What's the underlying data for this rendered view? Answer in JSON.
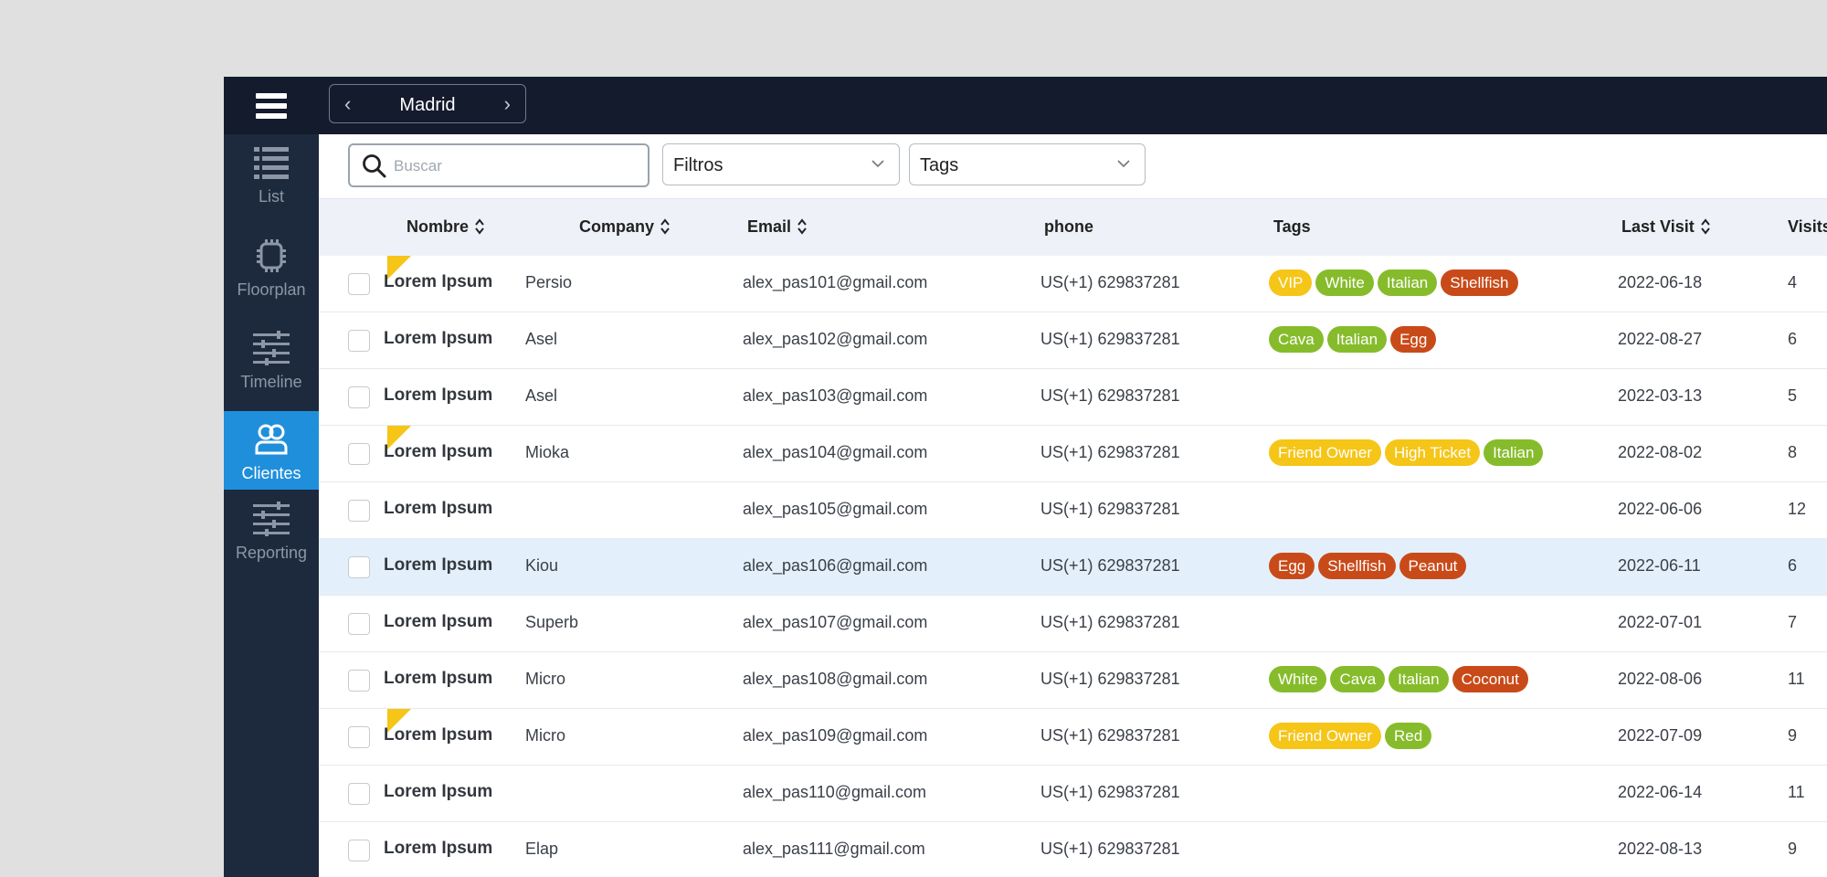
{
  "app": {
    "location": "Madrid",
    "nav": [
      {
        "label": "List",
        "icon": "list-icon",
        "active": false
      },
      {
        "label": "Floorplan",
        "icon": "floorplan-icon",
        "active": false
      },
      {
        "label": "Timeline",
        "icon": "timeline-icon",
        "active": false
      },
      {
        "label": "Clientes",
        "icon": "clients-icon",
        "active": true
      },
      {
        "label": "Reporting",
        "icon": "reporting-icon",
        "active": false
      }
    ]
  },
  "filters": {
    "search_placeholder": "Buscar",
    "filters_label": "Filtros",
    "tags_label": "Tags"
  },
  "table": {
    "columns": {
      "nombre": "Nombre",
      "company": "Company",
      "email": "Email",
      "phone": "phone",
      "tags": "Tags",
      "last_visit": "Last Visit",
      "visits": "Visits"
    },
    "tag_colors": {
      "yellow": "#f5c518",
      "green": "#86bc2b",
      "red": "#c94a19"
    },
    "rows": [
      {
        "name": "Lorem Ipsum",
        "company": "Persio",
        "email": "alex_pas101@gmail.com",
        "phone": "US(+1) 629837281",
        "tags": [
          {
            "text": "VIP",
            "color": "yellow"
          },
          {
            "text": "White",
            "color": "green"
          },
          {
            "text": "Italian",
            "color": "green"
          },
          {
            "text": "Shellfish",
            "color": "red"
          }
        ],
        "last_visit": "2022-06-18",
        "visits": "4",
        "flag": true,
        "selected": false
      },
      {
        "name": "Lorem Ipsum",
        "company": "Asel",
        "email": "alex_pas102@gmail.com",
        "phone": "US(+1) 629837281",
        "tags": [
          {
            "text": "Cava",
            "color": "green"
          },
          {
            "text": "Italian",
            "color": "green"
          },
          {
            "text": "Egg",
            "color": "red"
          }
        ],
        "last_visit": "2022-08-27",
        "visits": "6",
        "flag": false,
        "selected": false
      },
      {
        "name": "Lorem Ipsum",
        "company": "Asel",
        "email": "alex_pas103@gmail.com",
        "phone": "US(+1) 629837281",
        "tags": [],
        "last_visit": "2022-03-13",
        "visits": "5",
        "flag": false,
        "selected": false
      },
      {
        "name": "Lorem Ipsum",
        "company": "Mioka",
        "email": "alex_pas104@gmail.com",
        "phone": "US(+1) 629837281",
        "tags": [
          {
            "text": "Friend Owner",
            "color": "yellow"
          },
          {
            "text": "High Ticket",
            "color": "yellow"
          },
          {
            "text": "Italian",
            "color": "green"
          }
        ],
        "last_visit": "2022-08-02",
        "visits": "8",
        "flag": true,
        "selected": false
      },
      {
        "name": "Lorem Ipsum",
        "company": "",
        "email": "alex_pas105@gmail.com",
        "phone": "US(+1) 629837281",
        "tags": [],
        "last_visit": "2022-06-06",
        "visits": "12",
        "flag": false,
        "selected": false
      },
      {
        "name": "Lorem Ipsum",
        "company": "Kiou",
        "email": "alex_pas106@gmail.com",
        "phone": "US(+1) 629837281",
        "tags": [
          {
            "text": "Egg",
            "color": "red"
          },
          {
            "text": "Shellfish",
            "color": "red"
          },
          {
            "text": "Peanut",
            "color": "red"
          }
        ],
        "last_visit": "2022-06-11",
        "visits": "6",
        "flag": false,
        "selected": true
      },
      {
        "name": "Lorem Ipsum",
        "company": "Superb",
        "email": "alex_pas107@gmail.com",
        "phone": "US(+1) 629837281",
        "tags": [],
        "last_visit": "2022-07-01",
        "visits": "7",
        "flag": false,
        "selected": false
      },
      {
        "name": "Lorem Ipsum",
        "company": "Micro",
        "email": "alex_pas108@gmail.com",
        "phone": "US(+1) 629837281",
        "tags": [
          {
            "text": "White",
            "color": "green"
          },
          {
            "text": "Cava",
            "color": "green"
          },
          {
            "text": "Italian",
            "color": "green"
          },
          {
            "text": "Coconut",
            "color": "red"
          }
        ],
        "last_visit": "2022-08-06",
        "visits": "11",
        "flag": false,
        "selected": false
      },
      {
        "name": "Lorem Ipsum",
        "company": "Micro",
        "email": "alex_pas109@gmail.com",
        "phone": "US(+1) 629837281",
        "tags": [
          {
            "text": "Friend Owner",
            "color": "yellow"
          },
          {
            "text": "Red",
            "color": "green"
          }
        ],
        "last_visit": "2022-07-09",
        "visits": "9",
        "flag": true,
        "selected": false
      },
      {
        "name": "Lorem Ipsum",
        "company": "",
        "email": "alex_pas110@gmail.com",
        "phone": "US(+1) 629837281",
        "tags": [],
        "last_visit": "2022-06-14",
        "visits": "11",
        "flag": false,
        "selected": false
      },
      {
        "name": "Lorem Ipsum",
        "company": "Elap",
        "email": "alex_pas111@gmail.com",
        "phone": "US(+1) 629837281",
        "tags": [],
        "last_visit": "2022-08-13",
        "visits": "9",
        "flag": false,
        "selected": false
      }
    ]
  }
}
